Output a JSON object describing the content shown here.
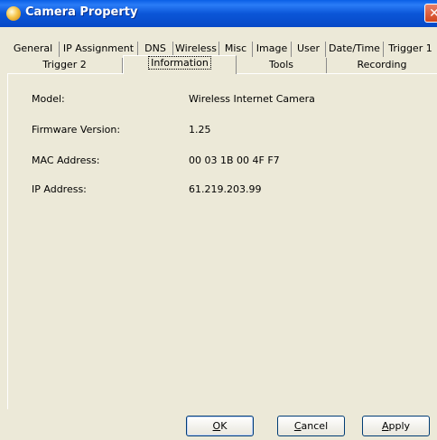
{
  "window": {
    "title": "Camera Property",
    "close_glyph": "✕"
  },
  "tabs_front": [
    "General",
    "IP Assignment",
    "DNS",
    "Wireless",
    "Misc",
    "Image",
    "User",
    "Date/Time",
    "Trigger 1"
  ],
  "tabs_back": [
    "Trigger 2",
    "Information",
    "Tools",
    "Recording"
  ],
  "selected_tab": "Information",
  "info": {
    "model_label": "Model:",
    "model_value": "Wireless Internet Camera",
    "firmware_label": "Firmware Version:",
    "firmware_value": "1.25",
    "mac_label": "MAC Address:",
    "mac_value": "00 03 1B 00 4F F7",
    "ip_label": "IP Address:",
    "ip_value": "61.219.203.99"
  },
  "buttons": {
    "ok": {
      "mnemonic": "O",
      "rest": "K"
    },
    "cancel": {
      "mnemonic": "C",
      "rest": "ancel"
    },
    "apply": {
      "mnemonic": "A",
      "rest": "pply"
    }
  }
}
